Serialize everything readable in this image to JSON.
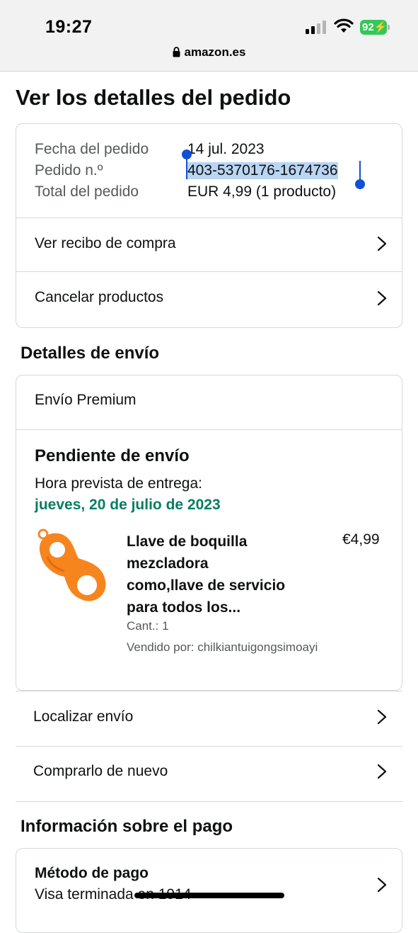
{
  "status_bar": {
    "time": "19:27",
    "battery": "92",
    "url": "amazon.es"
  },
  "page_title": "Ver los detalles del pedido",
  "order_summary": {
    "date_label": "Fecha del pedido",
    "date_value": "14 jul. 2023",
    "number_label": "Pedido n.º",
    "number_value": "403-5370176-1674736",
    "total_label": "Total del pedido",
    "total_value": "EUR 4,99 (1 producto)"
  },
  "order_actions": [
    "Ver recibo de compra",
    "Cancelar productos"
  ],
  "shipping": {
    "heading": "Detalles de envío",
    "method": "Envío Premium",
    "status": "Pendiente de envío",
    "eta_label": "Hora prevista de entrega:",
    "eta_date": "jueves, 20 de julio de 2023",
    "item": {
      "title_lines": [
        "Llave de boquilla",
        "mezcladora",
        "como,llave de servicio",
        "para todos los..."
      ],
      "price": "€4,99",
      "qty": "Cant.: 1",
      "seller": "Vendido por: chilkiantuigongsimoayi"
    }
  },
  "shipment_actions": [
    "Localizar envío",
    "Comprarlo de nuevo"
  ],
  "payment": {
    "heading": "Información sobre el pago",
    "method_label": "Método de pago",
    "method_value": "Visa terminada en 1914"
  },
  "colors": {
    "accent_green": "#067d62",
    "selection": "#b9d5f3",
    "handle": "#1150d6",
    "battery": "#34c759"
  }
}
